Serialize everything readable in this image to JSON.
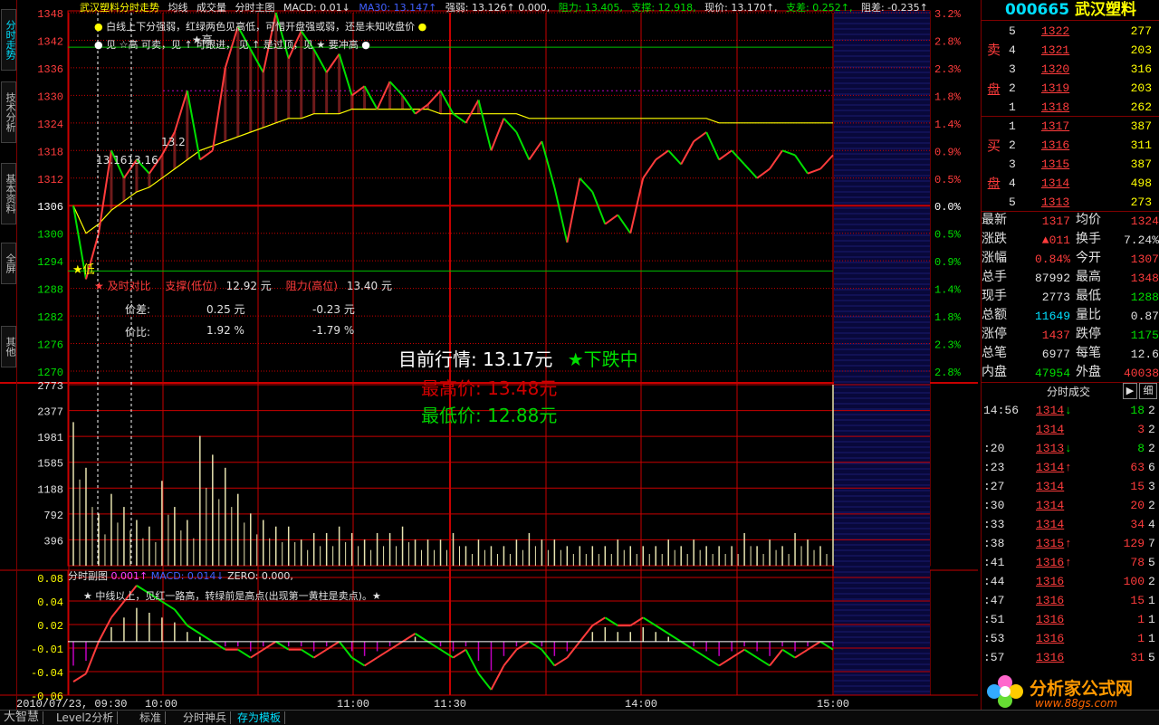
{
  "colors": {
    "up": "#ff3c3c",
    "down": "#00e000",
    "avg": "#ffff00",
    "bg": "#000000",
    "frame": "#c80000",
    "axis": "#ff3c3c"
  },
  "left_tabs": [
    "分时走势",
    "技术分析",
    "基本资料",
    "全屏",
    "其他"
  ],
  "header": {
    "stock_name": "武汉塑料分时走势",
    "items": [
      "均线",
      "成交量",
      "分时主图"
    ],
    "macd": "MACD: 0.01↓",
    "ma30": "MA30: 13.147↑",
    "qiangruo": "强弱: 13.126↑ 0.000,",
    "zuli": "阻力: 13.405,",
    "zhicheng": "支撑: 12.918,",
    "xianjia": "现价: 13.170↑,",
    "zhicha": "支差: 0.252↑,",
    "zuci": "阻差: -0.235↑"
  },
  "notes": {
    "line1": "白线上下分强弱，红绿两色见高低，可惜开盘强或弱，还是未知收盘价",
    "line2": "见 ☆高 可卖，见 ↑ 可跟进， 见 ↑ 是过顶，见 ★ 要冲高",
    "low_marker": "★低",
    "high_marker": "★高",
    "price_tag1": "13.1613.16",
    "price_tag2": "13.2"
  },
  "compare": {
    "title": "★ 及时对比",
    "support_label": "支撑(低位)",
    "support_value": "12.92 元",
    "resist_label": "阻力(高位)",
    "resist_value": "13.40 元",
    "diff_label": "价差:",
    "diff_support": "0.25 元",
    "diff_resist": "-0.23 元",
    "ratio_label": "价比:",
    "ratio_support": "1.92 %",
    "ratio_resist": "-1.79 %"
  },
  "summary": {
    "current_label": "目前行情:",
    "current_value": "13.17元",
    "trend": "★下跌中",
    "high_label": "最高价:",
    "high_value": "13.48元",
    "low_label": "最低价:",
    "low_value": "12.88元"
  },
  "price_axis": [
    "1348",
    "1342",
    "1336",
    "1330",
    "1324",
    "1318",
    "1312",
    "1306",
    "1300",
    "1294",
    "1288",
    "1282",
    "1276",
    "1270"
  ],
  "pct_axis": [
    "3.2%",
    "2.8%",
    "2.3%",
    "1.8%",
    "1.4%",
    "0.9%",
    "0.5%",
    "0.0%",
    "0.5%",
    "0.9%",
    "1.4%",
    "1.8%",
    "2.3%",
    "2.8%"
  ],
  "volume_axis": [
    "2773",
    "2377",
    "1981",
    "1585",
    "1188",
    "792",
    "396"
  ],
  "sub_axis": [
    "0.08",
    "0.04",
    "0.02",
    "-0.01",
    "-0.04",
    "-0.06"
  ],
  "sub_header": {
    "name": "分时副图",
    "v1": "0.001↑",
    "macd": "MACD: 0.014↓",
    "zero": "ZERO: 0.000,"
  },
  "sub_note": "★ 中线以上，见红一路高，转绿前是高点(出现第一黄柱是卖点)。★",
  "time_axis": [
    "2010/07/23, 09:30",
    "10:00",
    "11:00",
    "11:30",
    "14:00",
    "15:00"
  ],
  "quote": {
    "code": "000665",
    "name": "武汉塑料",
    "sell_label": [
      "卖",
      "盘"
    ],
    "buy_label": [
      "买",
      "盘"
    ],
    "asks": [
      {
        "n": "5",
        "p": "1322",
        "v": "277"
      },
      {
        "n": "4",
        "p": "1321",
        "v": "203"
      },
      {
        "n": "3",
        "p": "1320",
        "v": "316"
      },
      {
        "n": "2",
        "p": "1319",
        "v": "203"
      },
      {
        "n": "1",
        "p": "1318",
        "v": "262"
      }
    ],
    "bids": [
      {
        "n": "1",
        "p": "1317",
        "v": "387"
      },
      {
        "n": "2",
        "p": "1316",
        "v": "311"
      },
      {
        "n": "3",
        "p": "1315",
        "v": "387"
      },
      {
        "n": "4",
        "p": "1314",
        "v": "498"
      },
      {
        "n": "5",
        "p": "1313",
        "v": "273"
      }
    ],
    "stats": [
      {
        "l1": "最新",
        "v1": "1317",
        "c1": "red",
        "l2": "均价",
        "v2": "1324",
        "c2": "red"
      },
      {
        "l1": "涨跌",
        "v1": "▲011",
        "c1": "red",
        "l2": "换手",
        "v2": "7.24%",
        "c2": "wht"
      },
      {
        "l1": "涨幅",
        "v1": "0.84%",
        "c1": "red",
        "l2": "今开",
        "v2": "1307",
        "c2": "red"
      },
      {
        "l1": "总手",
        "v1": "87992",
        "c1": "wht",
        "l2": "最高",
        "v2": "1348",
        "c2": "red"
      },
      {
        "l1": "现手",
        "v1": "2773",
        "c1": "wht",
        "l2": "最低",
        "v2": "1288",
        "c2": "grn"
      },
      {
        "l1": "总额",
        "v1": "11649",
        "c1": "cyn",
        "l2": "量比",
        "v2": "0.87",
        "c2": "wht"
      },
      {
        "l1": "涨停",
        "v1": "1437",
        "c1": "red",
        "l2": "跌停",
        "v2": "1175",
        "c2": "grn"
      },
      {
        "l1": "总笔",
        "v1": "6977",
        "c1": "wht",
        "l2": "每笔",
        "v2": "12.6",
        "c2": "wht"
      },
      {
        "l1": "内盘",
        "v1": "47954",
        "c1": "grn",
        "l2": "外盘",
        "v2": "40038",
        "c2": "red"
      }
    ],
    "ticks_title": "分时成交",
    "ticks_btn": "细",
    "ticks": [
      {
        "t": "14:56",
        "p": "1314",
        "a": "↓",
        "ac": "grn",
        "v": "18",
        "n": "2"
      },
      {
        "t": "",
        "p": "1314",
        "a": "",
        "ac": "",
        "v": "3",
        "n": "2"
      },
      {
        "t": ":20",
        "p": "1313",
        "a": "↓",
        "ac": "grn",
        "v": "8",
        "n": "2"
      },
      {
        "t": ":23",
        "p": "1314",
        "a": "↑",
        "ac": "red",
        "v": "63",
        "n": "6"
      },
      {
        "t": ":27",
        "p": "1314",
        "a": "",
        "ac": "",
        "v": "15",
        "n": "3"
      },
      {
        "t": ":30",
        "p": "1314",
        "a": "",
        "ac": "",
        "v": "20",
        "n": "2"
      },
      {
        "t": ":33",
        "p": "1314",
        "a": "",
        "ac": "",
        "v": "34",
        "n": "4"
      },
      {
        "t": ":38",
        "p": "1315",
        "a": "↑",
        "ac": "red",
        "v": "129",
        "n": "7"
      },
      {
        "t": ":41",
        "p": "1316",
        "a": "↑",
        "ac": "red",
        "v": "78",
        "n": "5"
      },
      {
        "t": ":44",
        "p": "1316",
        "a": "",
        "ac": "",
        "v": "100",
        "n": "2"
      },
      {
        "t": ":47",
        "p": "1316",
        "a": "",
        "ac": "",
        "v": "15",
        "n": "1"
      },
      {
        "t": ":51",
        "p": "1316",
        "a": "",
        "ac": "",
        "v": "1",
        "n": "1"
      },
      {
        "t": ":53",
        "p": "1316",
        "a": "",
        "ac": "",
        "v": "1",
        "n": "1"
      },
      {
        "t": ":57",
        "p": "1316",
        "a": "",
        "ac": "",
        "v": "31",
        "n": "5"
      }
    ]
  },
  "bottom_tabs": [
    "大智慧",
    "Level2分析",
    "标准",
    "分时神兵",
    "存为模板"
  ],
  "watermark": {
    "brand": "分析家公式网",
    "url": "www.88gs.com"
  },
  "chart_data": {
    "type": "line",
    "title": "武汉塑料分时走势",
    "x_range": [
      "09:30",
      "15:00"
    ],
    "ylim": [
      1270,
      1348
    ],
    "prev_close": 1306,
    "support": 1291.8,
    "resist": 1340.5,
    "price": [
      1306,
      1290,
      1300,
      1318,
      1312,
      1316,
      1313,
      1317,
      1322,
      1331,
      1316,
      1318,
      1336,
      1345,
      1340,
      1335,
      1348,
      1338,
      1344,
      1340,
      1335,
      1339,
      1330,
      1332,
      1327,
      1333,
      1330,
      1326,
      1328,
      1331,
      1326,
      1324,
      1329,
      1318,
      1325,
      1322,
      1316,
      1320,
      1310,
      1298,
      1312,
      1309,
      1302,
      1304,
      1300,
      1312,
      1316,
      1318,
      1315,
      1320,
      1322,
      1316,
      1318,
      1315,
      1312,
      1314,
      1318,
      1317,
      1313,
      1314,
      1317
    ],
    "avg": [
      1306,
      1300,
      1302,
      1305,
      1307,
      1309,
      1310,
      1312,
      1314,
      1316,
      1318,
      1319,
      1320,
      1321,
      1322,
      1323,
      1324,
      1325,
      1325,
      1326,
      1326,
      1326,
      1327,
      1327,
      1327,
      1327,
      1327,
      1327,
      1327,
      1326,
      1326,
      1326,
      1326,
      1326,
      1326,
      1326,
      1325,
      1325,
      1325,
      1325,
      1325,
      1325,
      1325,
      1325,
      1325,
      1325,
      1325,
      1325,
      1325,
      1325,
      1325,
      1324,
      1324,
      1324,
      1324,
      1324,
      1324,
      1324,
      1324,
      1324,
      1324
    ],
    "volume": [
      2200,
      1500,
      800,
      1100,
      900,
      700,
      600,
      1300,
      900,
      700,
      1988,
      1700,
      1500,
      1100,
      800,
      700,
      600,
      600,
      400,
      500,
      500,
      600,
      500,
      400,
      500,
      500,
      600,
      400,
      400,
      400,
      500,
      300,
      400,
      300,
      300,
      400,
      500,
      400,
      400,
      300,
      300,
      300,
      300,
      400,
      300,
      300,
      300,
      400,
      300,
      400,
      300,
      300,
      300,
      500,
      300,
      400,
      300,
      500,
      400,
      300,
      2773
    ],
    "macd": [
      -0.05,
      -0.04,
      0.0,
      0.03,
      0.05,
      0.07,
      0.06,
      0.05,
      0.04,
      0.02,
      0.01,
      0.0,
      -0.01,
      -0.01,
      -0.02,
      -0.01,
      0.0,
      -0.01,
      -0.01,
      -0.02,
      -0.01,
      0.0,
      -0.02,
      -0.03,
      -0.02,
      -0.01,
      0.0,
      0.01,
      0.0,
      -0.01,
      -0.02,
      -0.01,
      -0.04,
      -0.06,
      -0.03,
      -0.01,
      0.0,
      -0.01,
      -0.03,
      -0.02,
      0.0,
      0.02,
      0.03,
      0.02,
      0.02,
      0.03,
      0.02,
      0.01,
      0.0,
      -0.01,
      -0.02,
      -0.03,
      -0.02,
      -0.01,
      -0.02,
      -0.03,
      -0.01,
      -0.02,
      -0.01,
      0.0,
      -0.01
    ]
  }
}
